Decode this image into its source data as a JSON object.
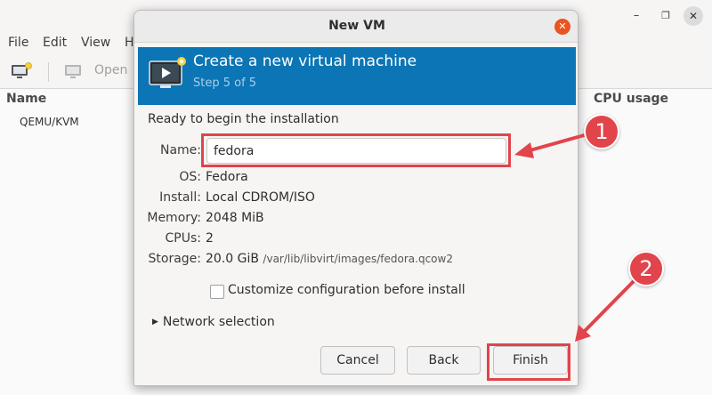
{
  "background_window": {
    "menu": [
      "File",
      "Edit",
      "View",
      "H"
    ],
    "toolbar": {
      "open_label": "Open"
    },
    "columns": {
      "name": "Name",
      "cpu": "CPU usage"
    },
    "connection": "QEMU/KVM"
  },
  "dialog": {
    "title": "New VM",
    "banner": {
      "title": "Create a new virtual machine",
      "step": "Step 5 of 5"
    },
    "ready_text": "Ready to begin the installation",
    "name_label": "Name:",
    "name_value": "fedora",
    "summary": [
      {
        "label": "OS:",
        "value": "Fedora"
      },
      {
        "label": "Install:",
        "value": "Local CDROM/ISO"
      },
      {
        "label": "Memory:",
        "value": "2048 MiB"
      },
      {
        "label": "CPUs:",
        "value": "2"
      }
    ],
    "storage": {
      "label": "Storage:",
      "size": "20.0 GiB",
      "path": "/var/lib/libvirt/images/fedora.qcow2"
    },
    "customize_label": "Customize configuration before install",
    "customize_checked": false,
    "network_label": "Network selection",
    "buttons": {
      "cancel": "Cancel",
      "back": "Back",
      "finish": "Finish"
    }
  },
  "annotations": {
    "badge_1": "1",
    "badge_2": "2"
  },
  "colors": {
    "banner": "#0b75b5",
    "annotation_red": "#e1444b",
    "close_orange": "#e95420"
  }
}
